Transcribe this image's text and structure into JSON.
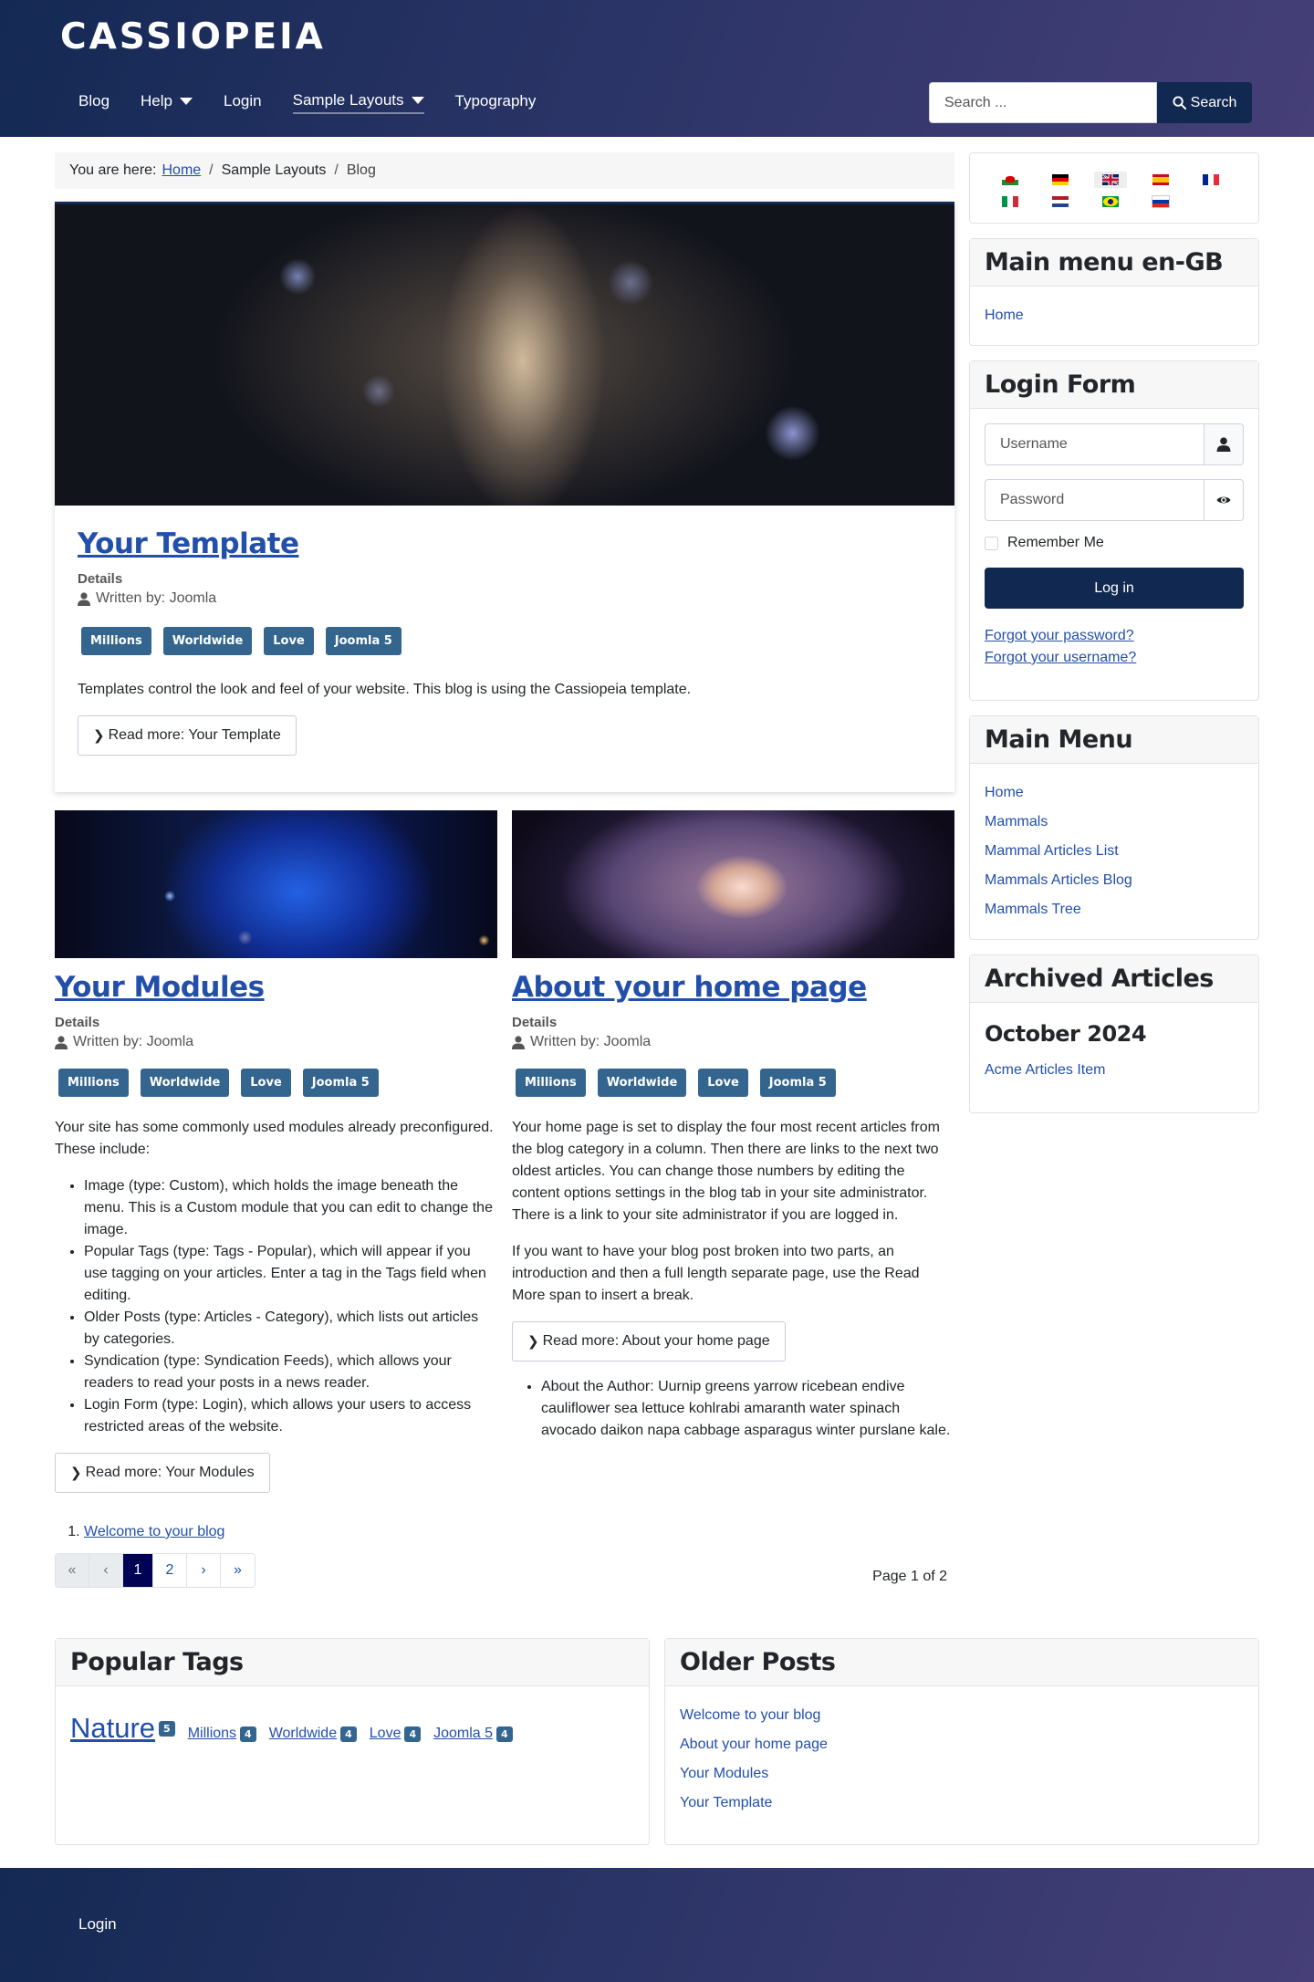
{
  "header": {
    "brand": "CASSIOPEIA",
    "nav": [
      {
        "label": "Blog",
        "dropdown": false,
        "active": false
      },
      {
        "label": "Help",
        "dropdown": true,
        "active": false
      },
      {
        "label": "Login",
        "dropdown": false,
        "active": false
      },
      {
        "label": "Sample Layouts",
        "dropdown": true,
        "active": true
      },
      {
        "label": "Typography",
        "dropdown": false,
        "active": false
      }
    ],
    "search": {
      "placeholder": "Search ...",
      "value": "",
      "button_label": "Search"
    }
  },
  "breadcrumb": {
    "prefix": "You are here:",
    "items": [
      "Home",
      "Sample Layouts",
      "Blog"
    ]
  },
  "lead_article": {
    "title": "Your Template",
    "details_label": "Details",
    "author": "Written by: Joomla",
    "tags": [
      "Millions",
      "Worldwide",
      "Love",
      "Joomla 5"
    ],
    "intro": "Templates control the look and feel of your website. This blog is using the Cassiopeia template.",
    "read_more": "Read more: Your Template"
  },
  "articles": [
    {
      "title": "Your Modules",
      "details_label": "Details",
      "author": "Written by: Joomla",
      "tags": [
        "Millions",
        "Worldwide",
        "Love",
        "Joomla 5"
      ],
      "paragraphs": [
        "Your site has some commonly used modules already preconfigured. These include:"
      ],
      "bullets": [
        "Image (type: Custom), which holds the image beneath the menu. This is a Custom module that you can edit to change the image.",
        "Popular Tags (type: Tags - Popular), which will appear if you use tagging on your articles. Enter a tag in the Tags field when editing.",
        "Older Posts (type: Articles - Category), which lists out articles by categories.",
        "Syndication (type: Syndication Feeds), which allows your readers to read your posts in a news reader.",
        "Login Form (type: Login), which allows your users to access restricted areas of the website."
      ],
      "read_more": "Read more: Your Modules"
    },
    {
      "title": "About your home page",
      "details_label": "Details",
      "author": "Written by: Joomla",
      "tags": [
        "Millions",
        "Worldwide",
        "Love",
        "Joomla 5"
      ],
      "paragraphs": [
        "Your home page is set to display the four most recent articles from the blog category in a column. Then there are links to the next two oldest articles. You can change those numbers by editing the content options settings in the blog tab in your site administrator. There is a link to your site administrator if you are logged in.",
        "If you want to have your blog post broken into two parts, an introduction and then a full length separate page, use the Read More span to insert a break."
      ],
      "read_more": "Read more: About your home page",
      "after_bullets": [
        "About the Author: Uurnip greens yarrow ricebean endive cauliflower sea lettuce kohlrabi amaranth water spinach avocado daikon napa cabbage asparagus winter purslane kale."
      ]
    }
  ],
  "more_links": [
    "Welcome to your blog"
  ],
  "pagination": {
    "first": "«",
    "prev": "‹",
    "pages": [
      "1",
      "2"
    ],
    "current": "1",
    "next": "›",
    "last": "»",
    "counter": "Page 1 of 2"
  },
  "sidebar": {
    "languages": {
      "flags": [
        {
          "code": "cy",
          "active": false
        },
        {
          "code": "de",
          "active": false
        },
        {
          "code": "en-GB",
          "active": true
        },
        {
          "code": "es",
          "active": false
        },
        {
          "code": "fr",
          "active": false
        },
        {
          "code": "it",
          "active": false
        },
        {
          "code": "nl",
          "active": false
        },
        {
          "code": "pt-BR",
          "active": false
        },
        {
          "code": "ru",
          "active": false
        }
      ]
    },
    "main_menu_en": {
      "title": "Main menu en-GB",
      "items": [
        "Home"
      ]
    },
    "login": {
      "title": "Login Form",
      "username_placeholder": "Username",
      "password_placeholder": "Password",
      "remember": "Remember Me",
      "button": "Log in",
      "forgot_password": "Forgot your password?",
      "forgot_username": "Forgot your username?"
    },
    "main_menu": {
      "title": "Main Menu",
      "items": [
        "Home",
        "Mammals",
        "Mammal Articles List",
        "Mammals Articles Blog",
        "Mammals Tree"
      ]
    },
    "archived": {
      "title": "Archived Articles",
      "month": "October 2024",
      "items": [
        "Acme Articles Item"
      ]
    }
  },
  "popular_tags": {
    "title": "Popular Tags",
    "tags": [
      {
        "label": "Nature",
        "count": "5"
      },
      {
        "label": "Millions",
        "count": "4"
      },
      {
        "label": "Worldwide",
        "count": "4"
      },
      {
        "label": "Love",
        "count": "4"
      },
      {
        "label": "Joomla 5",
        "count": "4"
      }
    ]
  },
  "older_posts": {
    "title": "Older Posts",
    "items": [
      "Welcome to your blog",
      "About your home page",
      "Your Modules",
      "Your Template"
    ]
  },
  "footer": {
    "link": "Login"
  },
  "colors": {
    "brand_dark": "#112850",
    "tag_bg": "#33658f",
    "link": "#224faa",
    "page_current": "#010156"
  }
}
